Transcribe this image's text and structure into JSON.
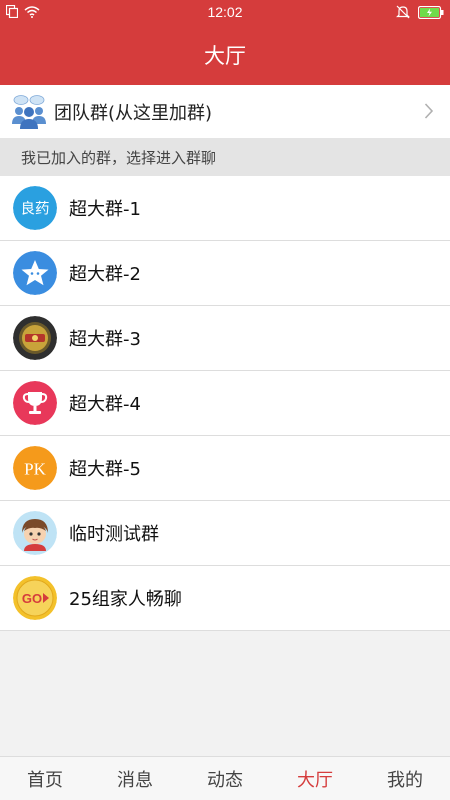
{
  "status_bar": {
    "time": "12:02"
  },
  "header": {
    "title": "大厅"
  },
  "team_entry": {
    "label": "团队群(从这里加群)"
  },
  "section": {
    "title": "我已加入的群，选择进入群聊"
  },
  "groups": [
    {
      "name": "超大群-1",
      "avatar_text": "良药",
      "avatar_color": "#2aa0e0"
    },
    {
      "name": "超大群-2",
      "avatar_color": "#3a8de0"
    },
    {
      "name": "超大群-3",
      "avatar_color": "#3a3a3a"
    },
    {
      "name": "超大群-4",
      "avatar_color": "#e8385a"
    },
    {
      "name": "超大群-5",
      "avatar_text": "PK",
      "avatar_color": "#f59a1b"
    },
    {
      "name": "临时测试群",
      "avatar_color": "#bfe3f5"
    },
    {
      "name": "25组家人畅聊",
      "avatar_text": "GO",
      "avatar_color": "#f3c12b"
    }
  ],
  "tabs": [
    {
      "label": "首页"
    },
    {
      "label": "消息"
    },
    {
      "label": "动态"
    },
    {
      "label": "大厅",
      "active": true
    },
    {
      "label": "我的"
    }
  ],
  "colors": {
    "primary": "#d53c3c"
  }
}
